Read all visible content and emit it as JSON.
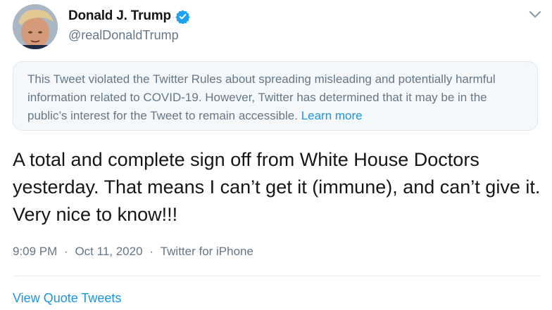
{
  "author": {
    "display_name": "Donald J. Trump",
    "handle": "@realDonaldTrump",
    "verified": true
  },
  "icons": {
    "avatar": "profile-photo",
    "verified": "verified-badge-icon",
    "menu": "chevron-down-icon"
  },
  "notice": {
    "text": "This Tweet violated the Twitter Rules about spreading misleading and potentially harmful information related to COVID-19. However, Twitter has determined that it may be in the public’s interest for the Tweet to remain accessible.",
    "link_label": "Learn more"
  },
  "tweet": {
    "text": "A total and complete sign off from White House Doctors yesterday. That means I can’t get it (immune), and can’t give it. Very nice to know!!!",
    "time": "9:09 PM",
    "separator": "·",
    "date": "Oct 11, 2020",
    "source": "Twitter for iPhone"
  },
  "actions": {
    "view_quotes_label": "View Quote Tweets"
  },
  "colors": {
    "link": "#1b95e0",
    "muted": "#657786",
    "notice_bg": "#f5f8fa",
    "verified": "#1da1f2"
  }
}
